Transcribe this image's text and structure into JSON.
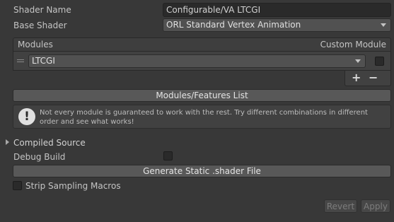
{
  "shader_name": {
    "label": "Shader Name",
    "value": "Configurable/VA LTCGI"
  },
  "base_shader": {
    "label": "Base Shader",
    "value": "ORL Standard Vertex Animation"
  },
  "modules": {
    "header_label": "Modules",
    "custom_module_label": "Custom Module",
    "items": [
      {
        "value": "LTCGI",
        "custom_module_checked": false
      }
    ],
    "add_label": "+",
    "remove_label": "−"
  },
  "modules_features_button": "Modules/Features List",
  "help_box": {
    "icon": "exclamation-icon",
    "text": "Not every module is guaranteed to work with the rest. Try different combinations in different order and see what works!"
  },
  "compiled_source": {
    "label": "Compiled Source",
    "expanded": false
  },
  "debug_build": {
    "label": "Debug Build",
    "checked": false
  },
  "generate_button": "Generate Static .shader File",
  "strip_sampling": {
    "label": "Strip Sampling Macros",
    "checked": false
  },
  "revert_button": "Revert",
  "apply_button": "Apply"
}
